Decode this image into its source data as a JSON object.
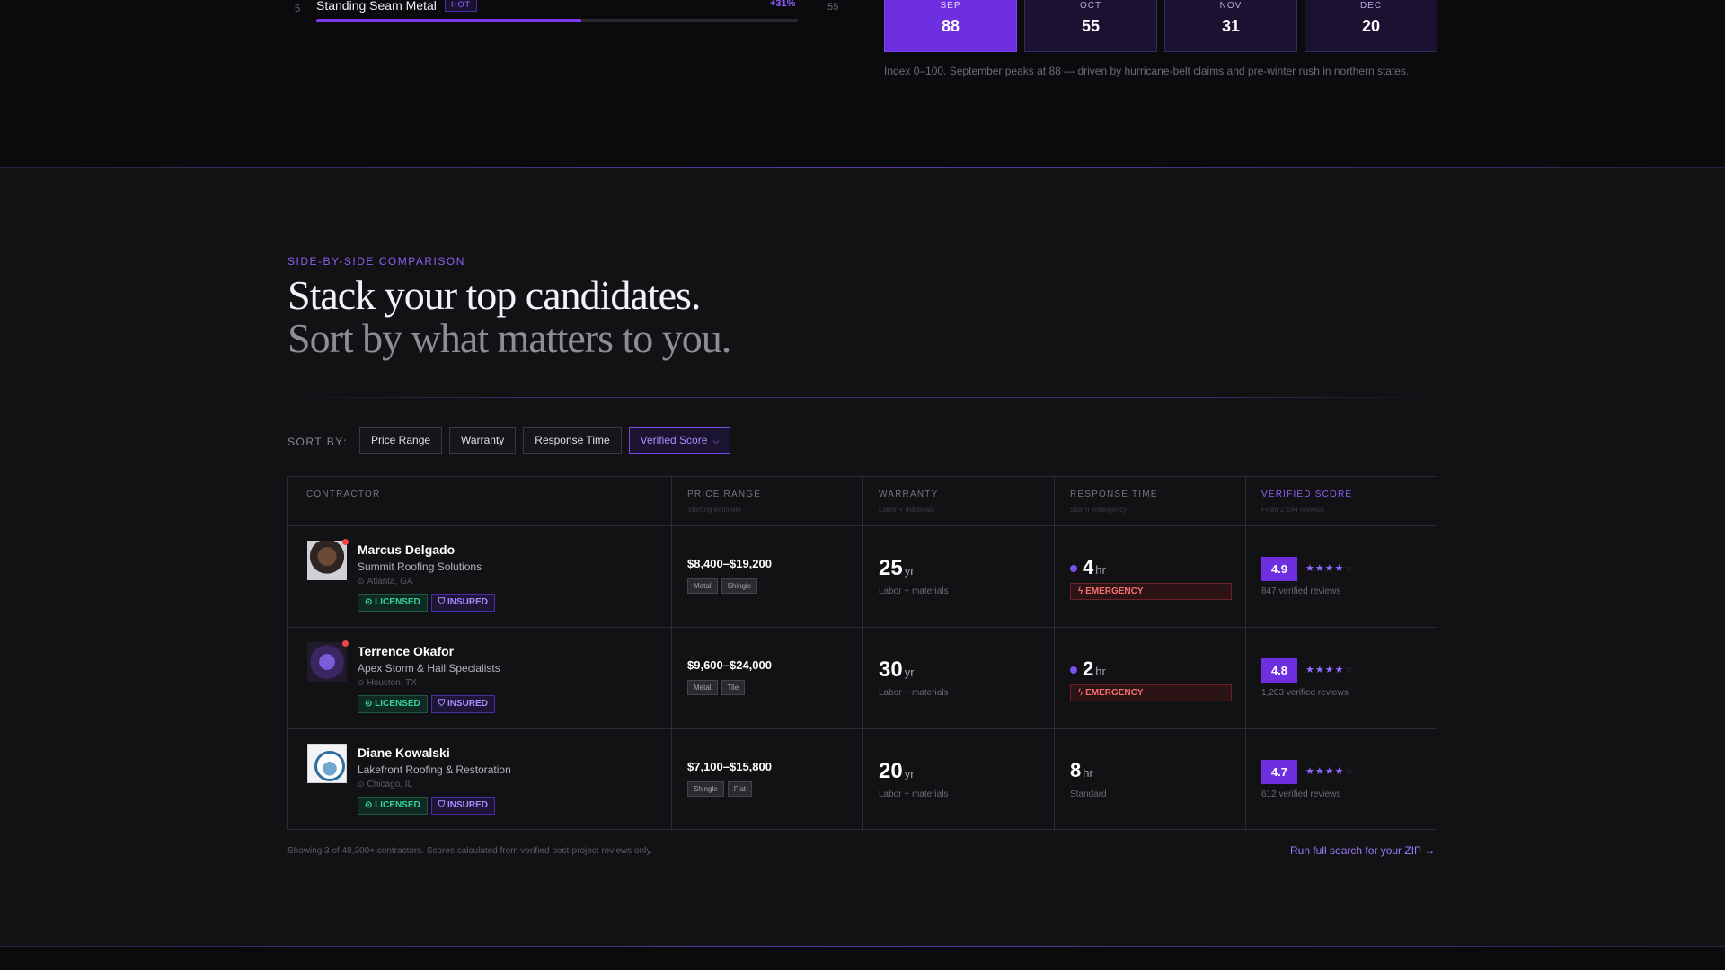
{
  "trend": {
    "rank": "5",
    "name": "Standing Seam Metal",
    "badge": "HOT",
    "change": "+31%",
    "fill_percent": 55,
    "next_rank": "55"
  },
  "seasonal": {
    "months": [
      {
        "name": "SEP",
        "value": "88"
      },
      {
        "name": "OCT",
        "value": "55"
      },
      {
        "name": "NOV",
        "value": "31"
      },
      {
        "name": "DEC",
        "value": "20"
      }
    ],
    "note": "Index 0–100. September peaks at 88 — driven by hurricane-belt claims and pre-winter rush in northern states."
  },
  "comparison": {
    "eyebrow": "SIDE-BY-SIDE COMPARISON",
    "headline_1": "Stack your top candidates.",
    "headline_2": "Sort by what matters to you.",
    "sort_label": "SORT BY:",
    "sort_options": [
      "Price Range",
      "Warranty",
      "Response Time",
      "Verified Score"
    ],
    "active_sort": "Verified Score",
    "columns": [
      {
        "title": "CONTRACTOR",
        "sub": ""
      },
      {
        "title": "PRICE RANGE",
        "sub": "Starting estimate"
      },
      {
        "title": "WARRANTY",
        "sub": "Labor + materials"
      },
      {
        "title": "RESPONSE TIME",
        "sub": "Storm emergency"
      },
      {
        "title": "VERIFIED SCORE",
        "sub": "From 2,194 reviews"
      }
    ],
    "rows": [
      {
        "name": "Marcus Delgado",
        "company": "Summit Roofing Solutions",
        "location": "Atlanta, GA",
        "licensed": "LICENSED",
        "insured": "INSURED",
        "price": "$8,400–$19,200",
        "tags": [
          "Metal",
          "Shingle"
        ],
        "warranty": "25",
        "warranty_unit": "yr",
        "warranty_sub": "Labor + materials",
        "response": "4",
        "response_unit": "hr",
        "response_tag": "EMERGENCY",
        "score": "4.9",
        "stars": 4,
        "reviews": "847 verified reviews"
      },
      {
        "name": "Terrence Okafor",
        "company": "Apex Storm & Hail Specialists",
        "location": "Houston, TX",
        "licensed": "LICENSED",
        "insured": "INSURED",
        "price": "$9,600–$24,000",
        "tags": [
          "Metal",
          "Tile"
        ],
        "warranty": "30",
        "warranty_unit": "yr",
        "warranty_sub": "Labor + materials",
        "response": "2",
        "response_unit": "hr",
        "response_tag": "EMERGENCY",
        "score": "4.8",
        "stars": 4,
        "reviews": "1,203 verified reviews"
      },
      {
        "name": "Diane Kowalski",
        "company": "Lakefront Roofing & Restoration",
        "location": "Chicago, IL",
        "licensed": "LICENSED",
        "insured": "INSURED",
        "price": "$7,100–$15,800",
        "tags": [
          "Shingle",
          "Flat"
        ],
        "warranty": "20",
        "warranty_unit": "yr",
        "warranty_sub": "Labor + materials",
        "response": "8",
        "response_unit": "hr",
        "response_sub": "Standard",
        "score": "4.7",
        "stars": 4,
        "reviews": "612 verified reviews"
      }
    ],
    "footnote": "Showing 3 of 48,300+ contractors. Scores calculated from verified post-project reviews only.",
    "run_link": "Run full search for your ZIP",
    "run_arrow": "→"
  },
  "icons": {
    "pin": "location-pin-icon",
    "check": "check-circle-icon",
    "shield": "shield-icon",
    "bolt": "bolt-icon",
    "star": "star-icon",
    "chevron": "chevron-down-icon",
    "arrow": "arrow-right-icon"
  },
  "colors": {
    "accent": "#6d2fe0",
    "accent_text": "#8a63f2",
    "licensed": "#34d399",
    "emergency": "#f87171",
    "background": "#121114"
  }
}
